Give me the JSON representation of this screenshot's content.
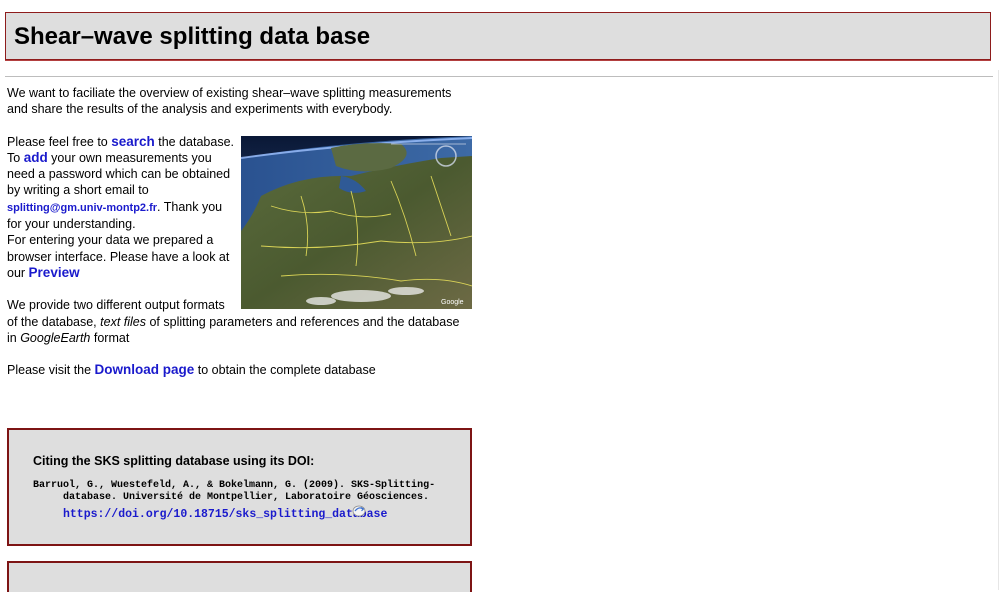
{
  "header": {
    "title": "Shear–wave splitting data base"
  },
  "intro": {
    "text": "We want to faciliate the overview of existing shear–wave splitting measurements and share the results of the analysis and experiments with everybody."
  },
  "search_para": {
    "before": "Please feel free to ",
    "search_link": "search",
    "after_search": " the database.",
    "to": "To ",
    "add_link": "add",
    "after_add": " your own measurements you need a password which can be obtained by writing a short email to ",
    "email_link": "splitting@gm.univ-montp2.fr",
    "after_email": ". Thank you for your understanding.",
    "entering": "For entering your data we prepared a browser interface. Please have a look at our ",
    "preview_link": "Preview"
  },
  "formats_para": {
    "before": "We provide two different output formats of the database, ",
    "text_files": "text files",
    "middle": " of splitting parameters and references and the database in ",
    "google_earth": "GoogleEarth",
    "after": " format"
  },
  "download_para": {
    "before": "Please visit the ",
    "download_link": "Download page",
    "after": " to obtain the complete database"
  },
  "earth_image": {
    "caption": "Google"
  },
  "citation": {
    "title": "Citing the SKS splitting database using its DOI:",
    "line1": "Barruol, G., Wuestefeld, A., & Bokelmann, G. (2009). SKS-Splitting-",
    "line2": "database. Université de Montpellier, Laboratoire Géosciences.",
    "doi": "https://doi.org/10.18715/sks_splitting_database"
  },
  "colors": {
    "link": "#1a1acc",
    "box_border": "#7d1414",
    "box_bg": "#dedede"
  }
}
